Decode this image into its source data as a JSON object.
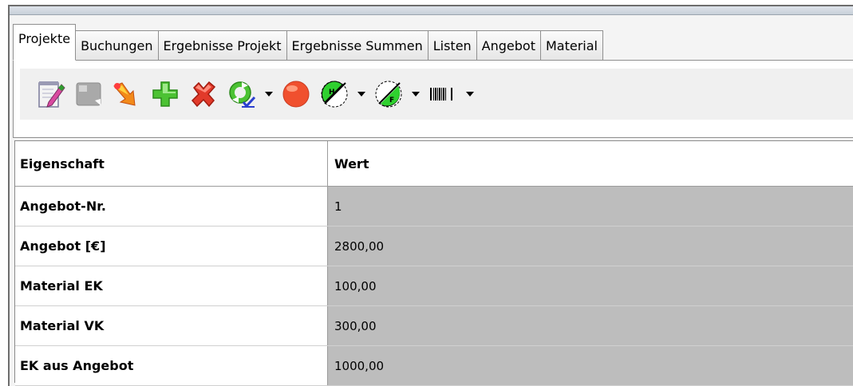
{
  "tabs": [
    {
      "label": "Projekte",
      "active": true
    },
    {
      "label": "Buchungen",
      "active": false
    },
    {
      "label": "Ergebnisse Projekt",
      "active": false
    },
    {
      "label": "Ergebnisse Summen",
      "active": false
    },
    {
      "label": "Listen",
      "active": false
    },
    {
      "label": "Angebot",
      "active": false
    },
    {
      "label": "Material",
      "active": false
    }
  ],
  "toolbar": {
    "icons": [
      "edit-notepad-icon",
      "gray-document-icon",
      "orange-arrow-icon",
      "green-plus-icon",
      "red-x-icon",
      "green-refresh-icon",
      "red-circle-icon",
      "green-h-icon",
      "green-f-icon",
      "barcode-icon"
    ]
  },
  "table": {
    "header": {
      "property": "Eigenschaft",
      "value": "Wert"
    },
    "rows": [
      {
        "property": "Angebot-Nr.",
        "value": "1"
      },
      {
        "property": "Angebot [€]",
        "value": "2800,00"
      },
      {
        "property": "Material EK",
        "value": "100,00"
      },
      {
        "property": "Material VK",
        "value": "300,00"
      },
      {
        "property": "EK aus Angebot",
        "value": "1000,00"
      }
    ]
  },
  "colors": {
    "value_cell_bg": "#bdbdbd",
    "toolbar_bg": "#f0f0f0",
    "tab_border": "#8f8f8f"
  }
}
